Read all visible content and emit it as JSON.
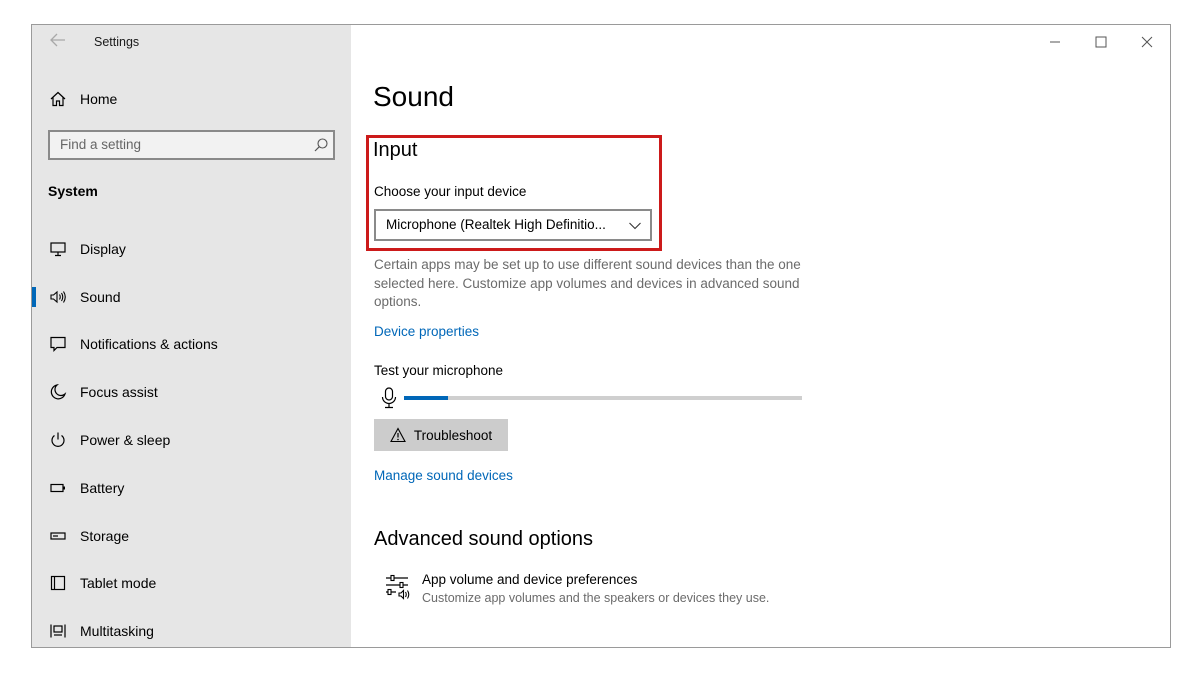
{
  "window": {
    "app_title": "Settings"
  },
  "sidebar": {
    "home_label": "Home",
    "search_placeholder": "Find a setting",
    "section_heading": "System",
    "items": [
      {
        "label": "Display",
        "icon": "display-icon"
      },
      {
        "label": "Sound",
        "icon": "speaker-icon",
        "active": true
      },
      {
        "label": "Notifications & actions",
        "icon": "notifications-icon"
      },
      {
        "label": "Focus assist",
        "icon": "moon-icon"
      },
      {
        "label": "Power & sleep",
        "icon": "power-icon"
      },
      {
        "label": "Battery",
        "icon": "battery-icon"
      },
      {
        "label": "Storage",
        "icon": "storage-icon"
      },
      {
        "label": "Tablet mode",
        "icon": "tablet-mode-icon"
      },
      {
        "label": "Multitasking",
        "icon": "multitasking-icon"
      }
    ]
  },
  "main": {
    "page_title": "Sound",
    "input": {
      "heading": "Input",
      "choose_label": "Choose your input device",
      "selected_device": "Microphone (Realtek High Definitio...",
      "description": "Certain apps may be set up to use different sound devices than the one selected here. Customize app volumes and devices in advanced sound options.",
      "device_properties_link": "Device properties",
      "test_label": "Test your microphone",
      "mic_level": 0.11,
      "troubleshoot_label": "Troubleshoot",
      "manage_link": "Manage sound devices"
    },
    "advanced": {
      "heading": "Advanced sound options",
      "item_title": "App volume and device preferences",
      "item_subtitle": "Customize app volumes and the speakers or devices they use."
    }
  },
  "colors": {
    "accent": "#0067b8",
    "highlight_box": "#cc1a1a",
    "sidebar_bg": "#e6e6e6"
  }
}
